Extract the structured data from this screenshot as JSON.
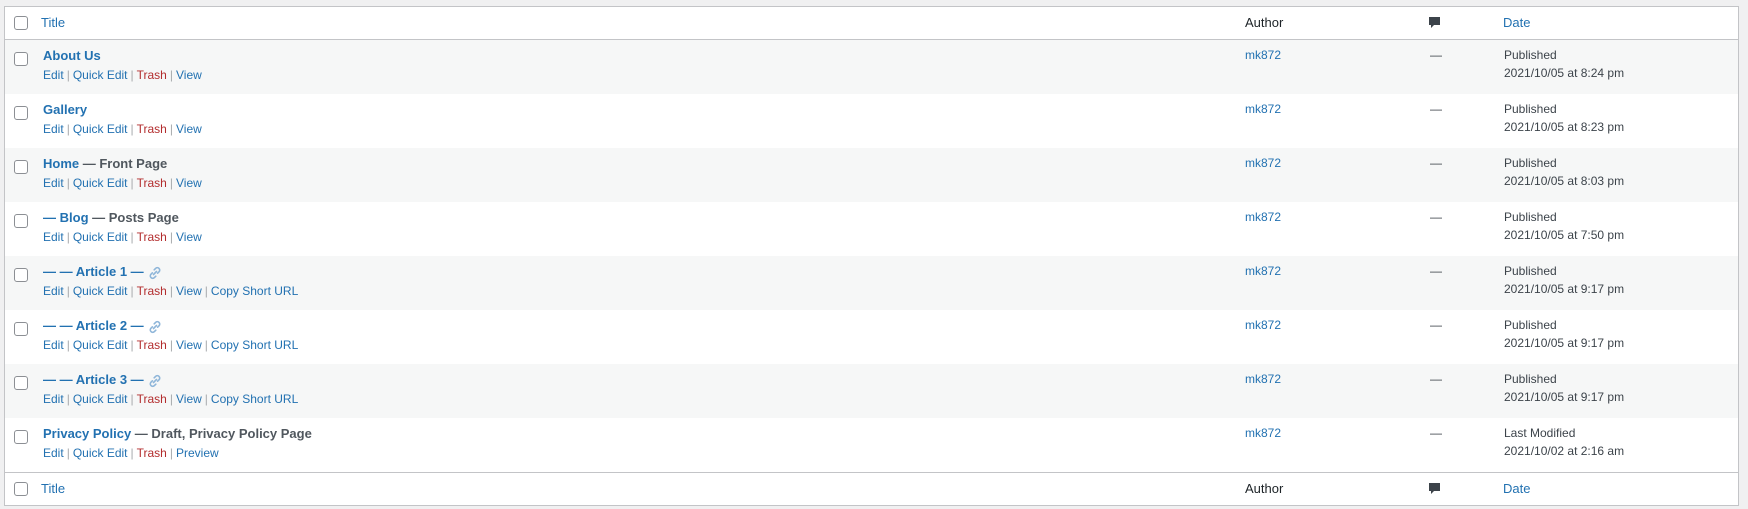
{
  "header": {
    "title": "Title",
    "author": "Author",
    "date": "Date",
    "comments_icon": "comment-bubble-icon"
  },
  "footer": {
    "title": "Title",
    "author": "Author",
    "date": "Date",
    "comments_icon": "comment-bubble-icon"
  },
  "rows": [
    {
      "prefix": "",
      "title": "About Us",
      "suffix": "",
      "state": "",
      "has_link_icon": false,
      "actions": [
        "Edit",
        "Quick Edit",
        "Trash",
        "View"
      ],
      "author": "mk872",
      "comments": "—",
      "date_status": "Published",
      "date": "2021/10/05 at 8:24 pm"
    },
    {
      "prefix": "",
      "title": "Gallery",
      "suffix": "",
      "state": "",
      "has_link_icon": false,
      "actions": [
        "Edit",
        "Quick Edit",
        "Trash",
        "View"
      ],
      "author": "mk872",
      "comments": "—",
      "date_status": "Published",
      "date": "2021/10/05 at 8:23 pm"
    },
    {
      "prefix": "",
      "title": "Home",
      "suffix": "",
      "state": "— Front Page",
      "has_link_icon": false,
      "actions": [
        "Edit",
        "Quick Edit",
        "Trash",
        "View"
      ],
      "author": "mk872",
      "comments": "—",
      "date_status": "Published",
      "date": "2021/10/05 at 8:03 pm"
    },
    {
      "prefix": "— ",
      "title": "Blog",
      "suffix": "",
      "state": "— Posts Page",
      "has_link_icon": false,
      "actions": [
        "Edit",
        "Quick Edit",
        "Trash",
        "View"
      ],
      "author": "mk872",
      "comments": "—",
      "date_status": "Published",
      "date": "2021/10/05 at 7:50 pm"
    },
    {
      "prefix": "— — ",
      "title": "Article 1",
      "suffix": " —",
      "state": "",
      "has_link_icon": true,
      "actions": [
        "Edit",
        "Quick Edit",
        "Trash",
        "View",
        "Copy Short URL"
      ],
      "author": "mk872",
      "comments": "—",
      "date_status": "Published",
      "date": "2021/10/05 at 9:17 pm"
    },
    {
      "prefix": "— — ",
      "title": "Article 2",
      "suffix": " —",
      "state": "",
      "has_link_icon": true,
      "actions": [
        "Edit",
        "Quick Edit",
        "Trash",
        "View",
        "Copy Short URL"
      ],
      "author": "mk872",
      "comments": "—",
      "date_status": "Published",
      "date": "2021/10/05 at 9:17 pm"
    },
    {
      "prefix": "— — ",
      "title": "Article 3",
      "suffix": " —",
      "state": "",
      "has_link_icon": true,
      "actions": [
        "Edit",
        "Quick Edit",
        "Trash",
        "View",
        "Copy Short URL"
      ],
      "author": "mk872",
      "comments": "—",
      "date_status": "Published",
      "date": "2021/10/05 at 9:17 pm"
    },
    {
      "prefix": "",
      "title": "Privacy Policy",
      "suffix": "",
      "state": "— Draft, Privacy Policy Page",
      "has_link_icon": false,
      "actions": [
        "Edit",
        "Quick Edit",
        "Trash",
        "Preview"
      ],
      "author": "mk872",
      "comments": "—",
      "date_status": "Last Modified",
      "date": "2021/10/02 at 2:16 am"
    }
  ],
  "colors": {
    "link": "#2271b1",
    "trash": "#b32d2e",
    "alt_row": "#f6f7f7",
    "border": "#c3c4c7"
  }
}
